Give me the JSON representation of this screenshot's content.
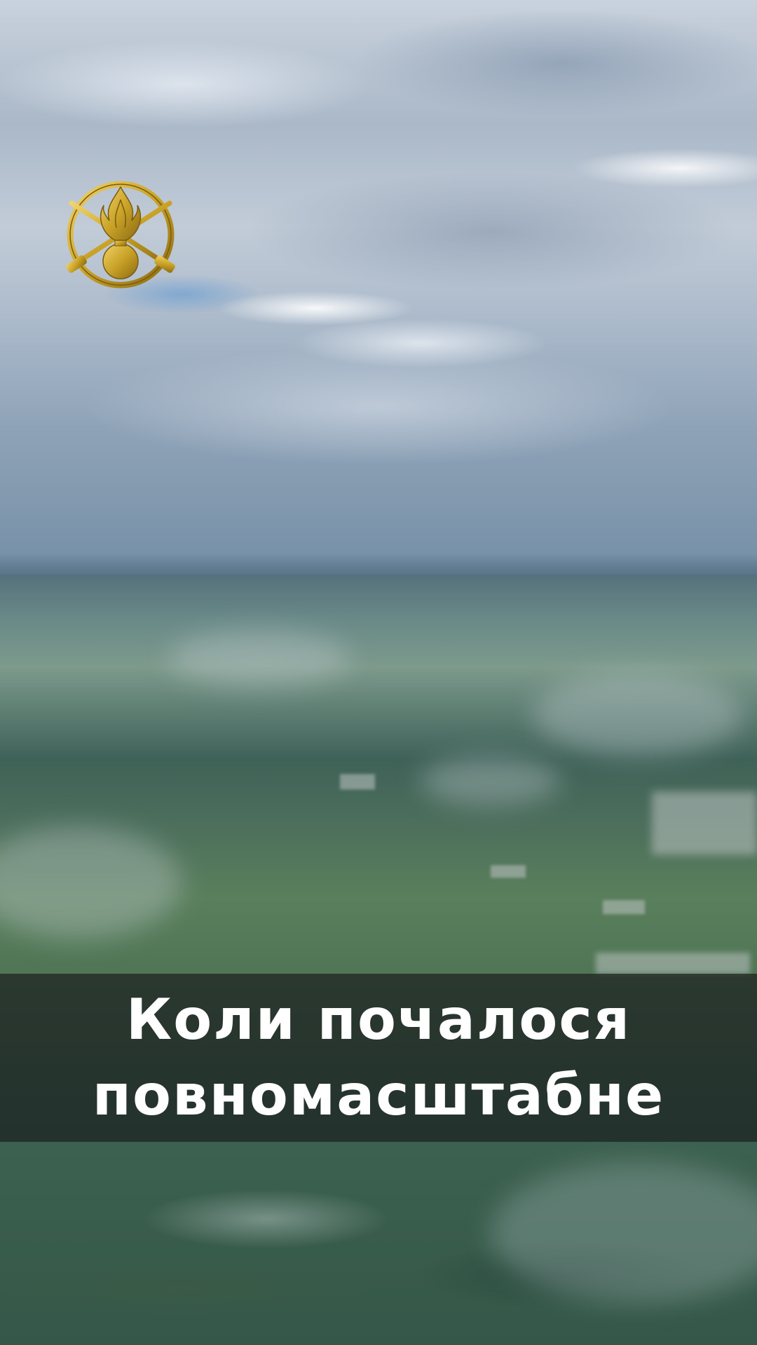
{
  "caption": {
    "line1": "Коли почалося",
    "line2": "повномасштабне"
  },
  "emblem": {
    "icon": "crossed-rifles-grenade-emblem",
    "color": "#c9a227"
  },
  "colors": {
    "caption_text": "#ffffff",
    "caption_band": "rgba(25,28,30,0.68)"
  }
}
